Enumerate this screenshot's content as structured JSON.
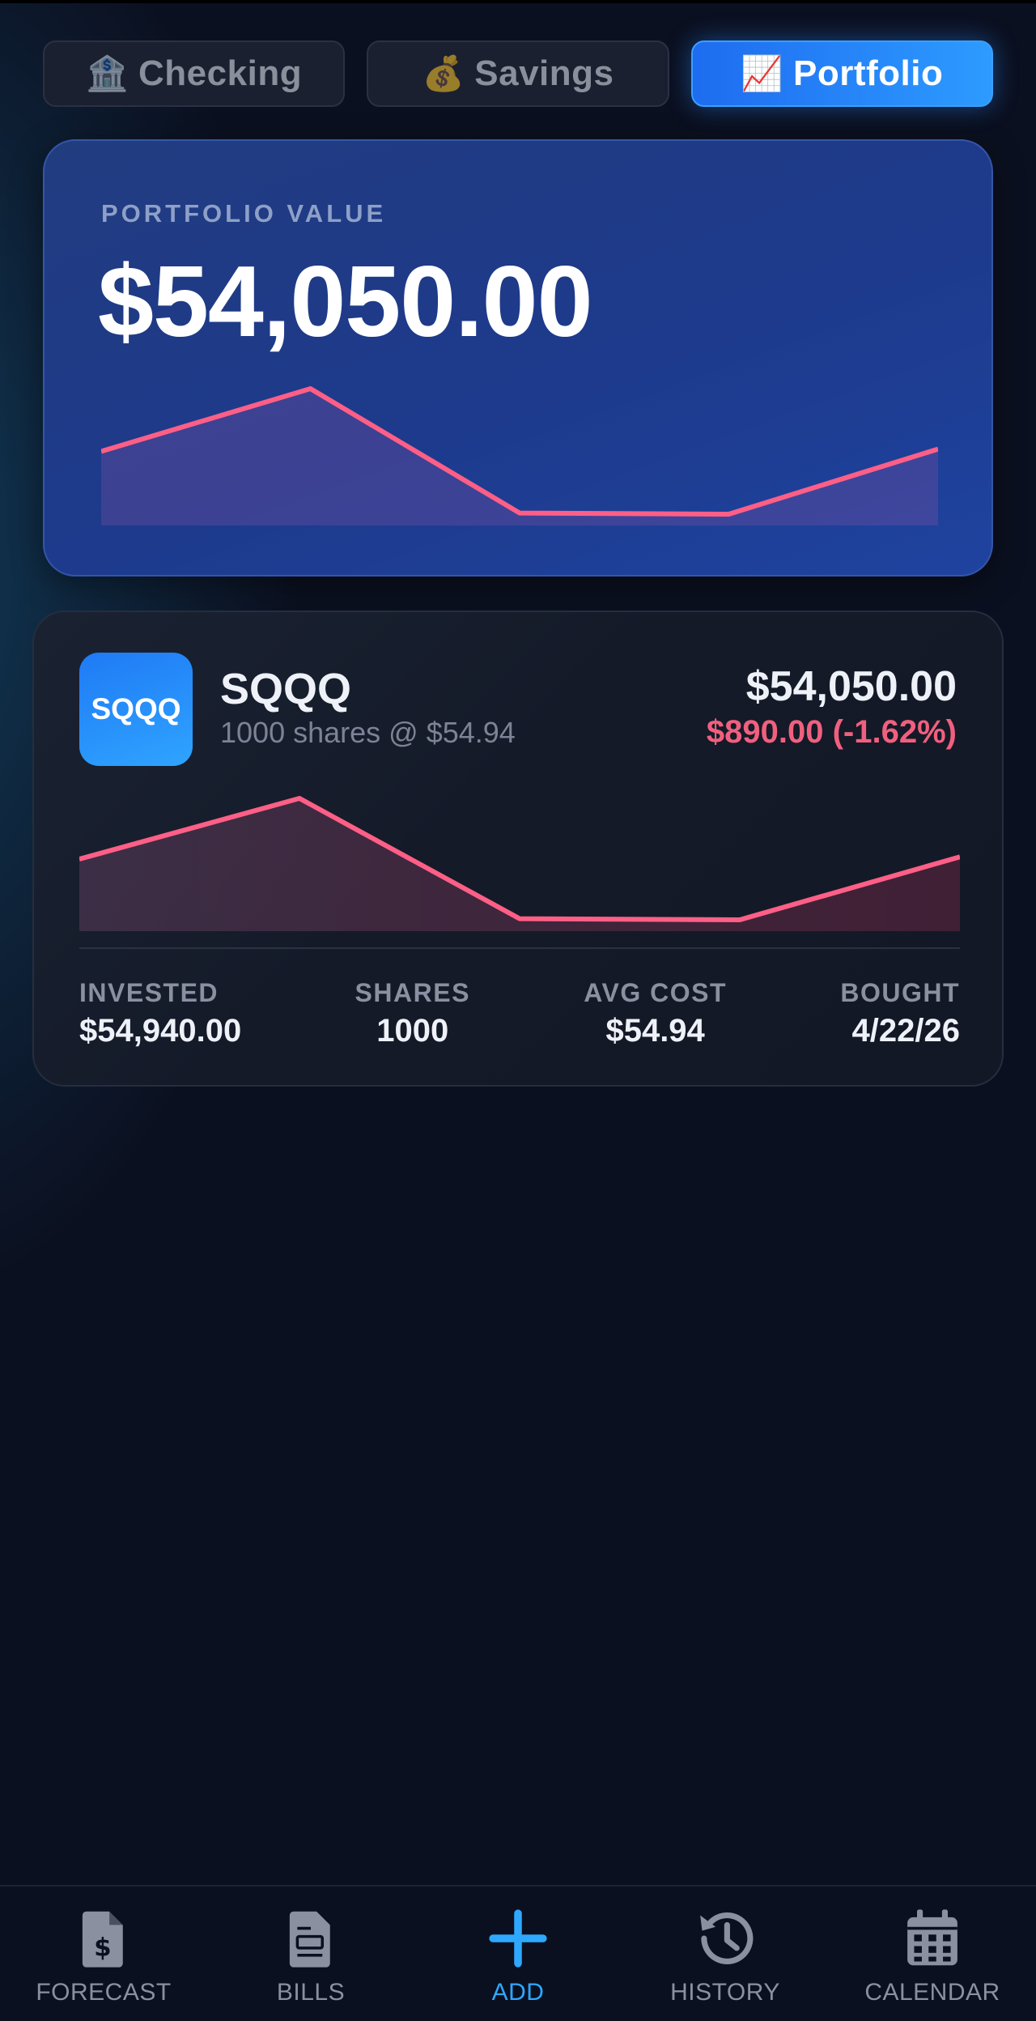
{
  "tabs": [
    {
      "emoji": "🏦",
      "label": "Checking",
      "active": false
    },
    {
      "emoji": "💰",
      "label": "Savings",
      "active": false
    },
    {
      "emoji": "📈",
      "label": "Portfolio",
      "active": true
    }
  ],
  "portfolio": {
    "label": "PORTFOLIO VALUE",
    "value": "$54,050.00"
  },
  "holding": {
    "logo_text": "SQQQ",
    "ticker": "SQQQ",
    "shares_line": "1000 shares @ $54.94",
    "value": "$54,050.00",
    "change": "$890.00 (-1.62%)",
    "change_color": "#f0607e",
    "stats": [
      {
        "label": "INVESTED",
        "value": "$54,940.00"
      },
      {
        "label": "SHARES",
        "value": "1000"
      },
      {
        "label": "AVG COST",
        "value": "$54.94"
      },
      {
        "label": "BOUGHT",
        "value": "4/22/26"
      }
    ]
  },
  "sparkline": {
    "values": [
      54560,
      55100,
      54030,
      54020,
      54580
    ],
    "line_color": "#ff5f86"
  },
  "nav": [
    {
      "icon": "forecast-icon",
      "label": "FORECAST",
      "active": false
    },
    {
      "icon": "bills-icon",
      "label": "BILLS",
      "active": false
    },
    {
      "icon": "add-icon",
      "label": "ADD",
      "active": true
    },
    {
      "icon": "history-icon",
      "label": "HISTORY",
      "active": false
    },
    {
      "icon": "calendar-icon",
      "label": "CALENDAR",
      "active": false
    }
  ],
  "colors": {
    "accent": "#2d9bff",
    "background": "#0b1020",
    "negative": "#f0607e"
  }
}
